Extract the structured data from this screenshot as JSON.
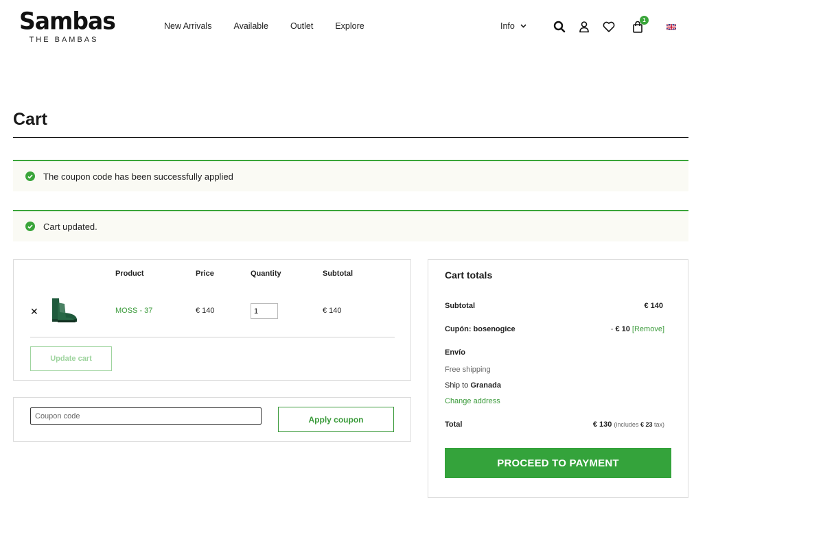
{
  "brand": {
    "logo_text": "Sambas",
    "logo_sub": "THE BAMBAS"
  },
  "nav": {
    "items": [
      "New Arrivals",
      "Available",
      "Outlet",
      "Explore"
    ],
    "info_label": "Info",
    "cart_count": "1"
  },
  "page": {
    "title": "Cart"
  },
  "notices": {
    "coupon_applied": "The coupon code has been successfully applied",
    "cart_updated": "Cart updated."
  },
  "cart_table": {
    "headers": {
      "product": "Product",
      "price": "Price",
      "quantity": "Quantity",
      "subtotal": "Subtotal"
    },
    "rows": [
      {
        "name": "MOSS - 37",
        "price": "€ 140",
        "quantity": "1",
        "subtotal": "€ 140"
      }
    ],
    "update_label": "Update cart"
  },
  "coupon": {
    "placeholder": "Coupon code",
    "apply_label": "Apply coupon"
  },
  "totals": {
    "title": "Cart totals",
    "subtotal_label": "Subtotal",
    "subtotal_value": "€ 140",
    "coupon_label": "Cupón: bosenogice",
    "coupon_prefix": "- ",
    "coupon_value": "€ 10",
    "coupon_remove": "[Remove]",
    "shipping_label": "Envío",
    "shipping_method": "Free shipping",
    "ship_to_prefix": "Ship to ",
    "ship_to_city": "Granada",
    "change_address": "Change address",
    "total_label": "Total",
    "total_value": "€ 130",
    "tax_prefix": "(includes ",
    "tax_value": "€ 23",
    "tax_suffix": " tax)",
    "checkout_label": "PROCEED TO PAYMENT"
  },
  "colors": {
    "accent": "#34a33b",
    "link": "#3a9a3a",
    "notice_bg": "#fafaf4"
  }
}
